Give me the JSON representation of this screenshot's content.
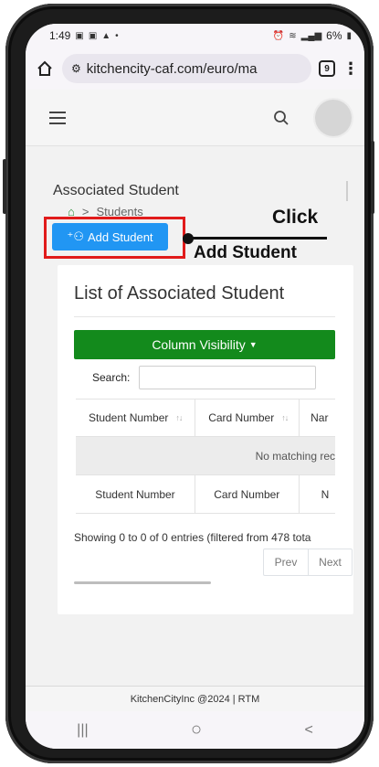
{
  "status_bar": {
    "time": "1:49",
    "battery": "6%",
    "left_icons": [
      "image-icon",
      "message-icon",
      "shop-icon",
      "dot-icon"
    ],
    "right_icons": [
      "alarm-icon",
      "wifi-icon",
      "volte-icon",
      "signal-icon",
      "signal-icon",
      "battery-icon"
    ]
  },
  "browser": {
    "url": "kitchencity-caf.com/euro/ma",
    "tab_count": "9"
  },
  "page": {
    "title": "Associated Student",
    "breadcrumb_current": "Students",
    "add_button_label": "Add Student"
  },
  "annotation": {
    "line1": "Click",
    "line2": "Add Student",
    "highlight_color": "#e11b1b"
  },
  "card": {
    "title": "List of Associated Student",
    "column_visibility_label": "Column Visibility",
    "search_label": "Search:",
    "search_value": "",
    "table": {
      "headers": [
        "Student Number",
        "Card Number",
        "Nar"
      ],
      "footers": [
        "Student Number",
        "Card Number",
        "N"
      ],
      "empty_message": "No matching rec"
    },
    "info": "Showing 0 to 0 of 0 entries (filtered from 478 tota",
    "pagination": {
      "prev": "Prev",
      "next": "Next"
    }
  },
  "footer": {
    "text": "KitchenCityInc @2024 | RTM"
  },
  "nav": {
    "recents": "|||",
    "home": "○",
    "back": "<"
  },
  "colors": {
    "primary": "#2196f3",
    "success": "#138a1c"
  }
}
